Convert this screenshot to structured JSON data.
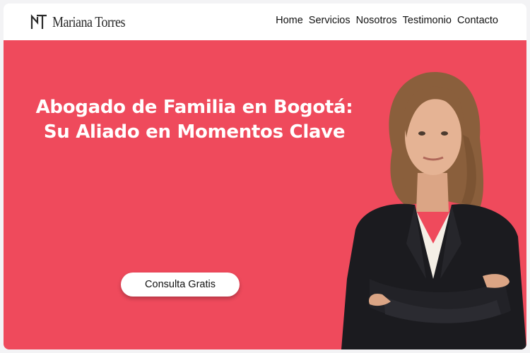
{
  "header": {
    "brand": "Mariana Torres",
    "logo_icon": "mt-monogram-icon",
    "nav": [
      {
        "label": "Home"
      },
      {
        "label": "Servicios"
      },
      {
        "label": "Nosotros"
      },
      {
        "label": "Testimonio"
      },
      {
        "label": "Contacto"
      }
    ]
  },
  "hero": {
    "headline_line1": "Abogado de Familia en Bogotá:",
    "headline_line2": "Su Aliado en Momentos Clave",
    "cta_label": "Consulta Gratis",
    "portrait": "lawyer-portrait-image"
  },
  "colors": {
    "hero_background": "#ef4a5c",
    "header_background": "#ffffff",
    "text_dark": "#111111",
    "button_background": "#ffffff"
  }
}
